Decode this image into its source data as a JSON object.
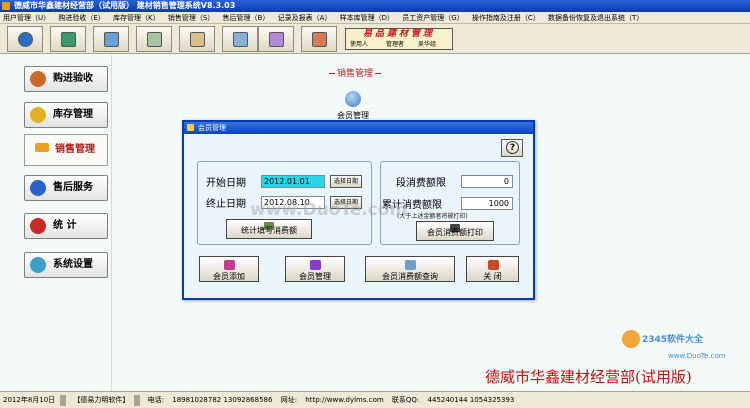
{
  "window": {
    "title": "德威市华鑫建材经营部（试用版） 建材销售管理系统V8.3.03"
  },
  "menu": [
    "用户管理（U）",
    "购进验收（E）",
    "库存管理（K）",
    "销售管理（S）",
    "售后管理（B）",
    "记录及报表（A）",
    "样本库管理（D）",
    "员工资产管理（G）",
    "操作指南及注册（C）",
    "数据备份恢复及退出系统（T）"
  ],
  "banner": {
    "title": "易品建材管理",
    "user_label": "使用人",
    "role": "管理者",
    "name": "吴华组"
  },
  "sidebar": {
    "items": [
      {
        "label": "购进验收"
      },
      {
        "label": "库存管理"
      },
      {
        "label": "销售管理"
      },
      {
        "label": "售后服务"
      },
      {
        "label": "统  计"
      },
      {
        "label": "系统设置"
      }
    ]
  },
  "main": {
    "section_title": "销售管理",
    "member_icon_label": "会员管理"
  },
  "dialog": {
    "title": "会员管理",
    "start_label": "开始日期",
    "start_value": "2012.01.01",
    "end_label": "终止日期",
    "end_value": "2012.08.10",
    "pick_date": "选择日期",
    "period_label": "段消费额限",
    "period_value": "0",
    "total_label": "累计消费额限",
    "total_value": "1000",
    "note": "(大于上述金额者将被打印)",
    "stats_btn": "统计填写消费额",
    "print_btn": "会员消费额打印",
    "add_btn": "会员添加",
    "manage_btn": "会员管理",
    "query_btn": "会员消费额查询",
    "close_btn": "关 闭"
  },
  "footer": {
    "company": "德威市华鑫建材经营部(试用版)",
    "date": "2012年8月10日",
    "software": "【德易力明软件】",
    "phone_label": "电话:",
    "phones": "18981028782  13092868586",
    "web_label": "网址:",
    "web": "http://www.dylms.com",
    "qq_label": "联系QQ:",
    "qq": "445240144  1054325393"
  },
  "watermarks": {
    "center": "www.DuoTe.com",
    "corner_brand": "2345软件大全",
    "corner_site": "www.DuoTe.com"
  },
  "colors": {
    "title_bar": "#0a3ab0",
    "accent_red": "#c9181f",
    "field_highlight": "#29d6e6",
    "workspace": "#f2f9f6"
  },
  "icons": {
    "toolbar": [
      "refresh-icon",
      "stock-in-icon",
      "search-icon",
      "inventory-icon",
      "report-icon",
      "calendar-icon",
      "employee-icon",
      "exit-icon"
    ]
  }
}
